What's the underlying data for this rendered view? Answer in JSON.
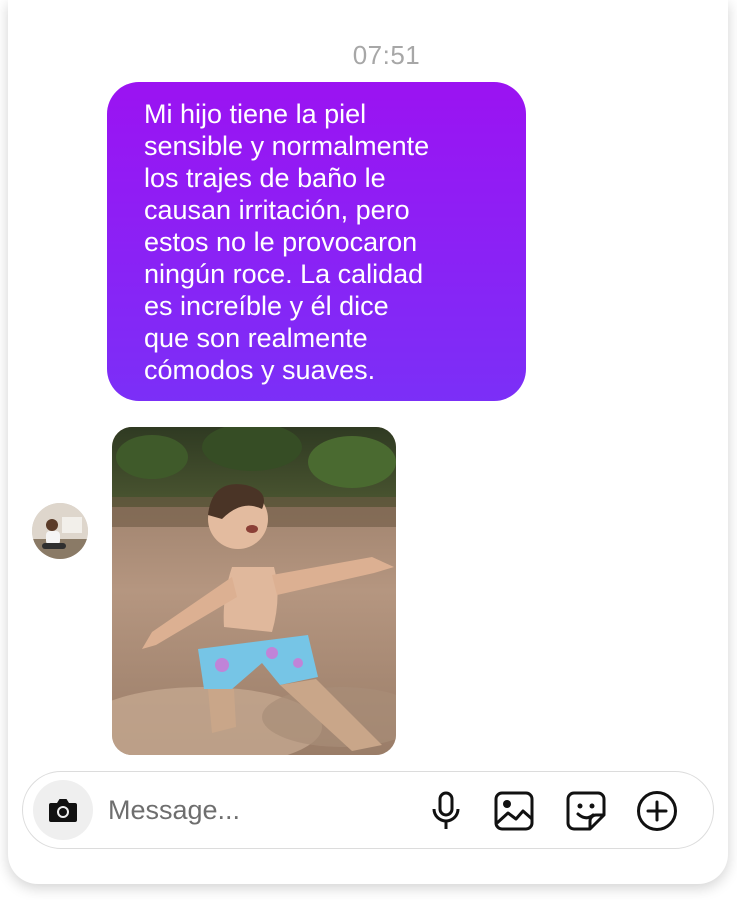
{
  "chat": {
    "timestamp": "07:51",
    "message_text": "Mi hijo tiene la piel\nsensible y normalmente\nlos trajes de baño le\ncausan irritación, pero\nestos no le provocaron\nningún roce. La calidad\nes increíble y él dice\nque son realmente\ncómodos y suaves.",
    "bubble_gradient": [
      "#9b13f2",
      "#7b2ff7"
    ]
  },
  "composer": {
    "placeholder": "Message...",
    "icons": [
      "camera-icon",
      "microphone-icon",
      "gallery-icon",
      "sticker-icon",
      "add-icon"
    ]
  }
}
